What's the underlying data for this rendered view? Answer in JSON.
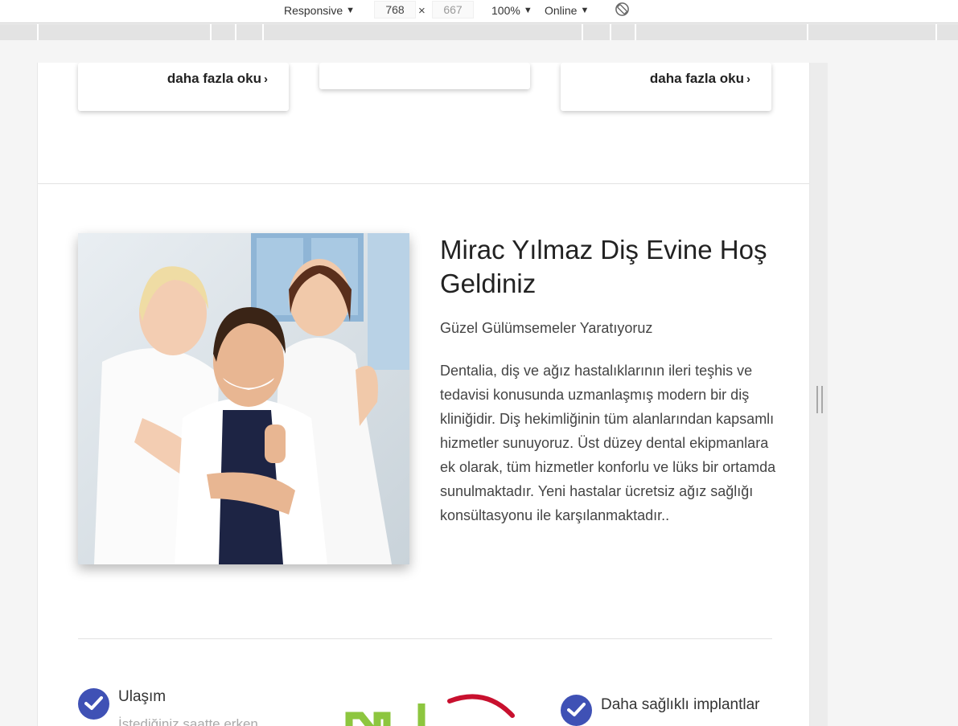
{
  "devtools": {
    "device_label": "Responsive",
    "width_value": "768",
    "times": "×",
    "height_value": "667",
    "zoom_label": "100%",
    "network_label": "Online",
    "dropdown_arrow": "▼"
  },
  "cards": {
    "left_link": "daha fazla oku",
    "right_link": "daha fazla oku",
    "chevron": "›"
  },
  "welcome": {
    "title": "Mirac Yılmaz Diş Evine Hoş Geldiniz",
    "subtitle": "Güzel Gülümsemeler Yaratıyoruz",
    "body": "Dentalia, diş ve ağız hastalıklarının ileri teşhis ve tedavisi konusunda uzmanlaşmış modern bir diş kliniğidir. Diş hekimliğinin tüm alanlarından kapsamlı hizmetler sunuyoruz. Üst düzey dental ekipmanlara ek olarak, tüm hizmetler konforlu ve lüks bir ortamda sunulmaktadır. Yeni hastalar ücretsiz ağız sağlığı konsültasyonu ile karşılanmaktadır.."
  },
  "features": {
    "left_title": "Ulaşım",
    "left_desc": "İstediğiniz saatte erken",
    "right_title": "Daha sağlıklı implantlar"
  },
  "colors": {
    "accent_blue": "#3f51b5",
    "logo_green": "#8dc63f",
    "logo_red": "#c8102e"
  }
}
